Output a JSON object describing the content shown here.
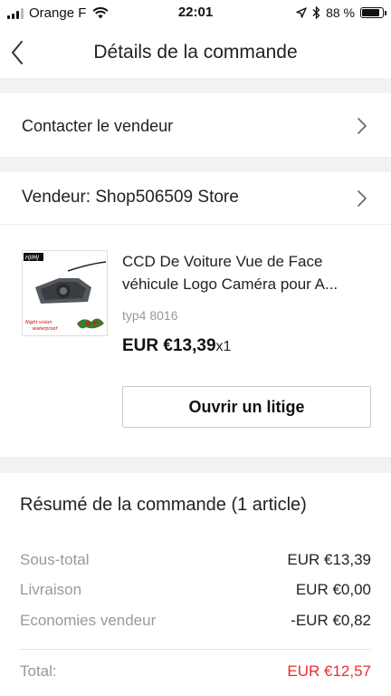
{
  "status_bar": {
    "carrier": "Orange F",
    "time": "22:01",
    "battery_percent": "88 %",
    "battery_level": 0.88
  },
  "nav": {
    "title": "Détails de la commande",
    "back_icon": "chevron-left-icon"
  },
  "contact_seller": {
    "label": "Contacter le vendeur",
    "icon": "chevron-right-icon"
  },
  "seller": {
    "label": "Vendeur: Shop506509 Store",
    "icon": "chevron-right-icon"
  },
  "product": {
    "name_line1": "CCD De Voiture Vue de Face",
    "name_line2": "véhicule Logo Caméra pour A...",
    "variant": "typ4 8016",
    "price": "EUR €13,39",
    "quantity": "x1",
    "image_brand": "HJIMJ",
    "image_caption_1": "Night vision",
    "image_caption_2": "waterproof",
    "dispute_button": "Ouvrir un litige"
  },
  "summary": {
    "title": "Résumé de la commande (1 article)",
    "lines": [
      {
        "label": "Sous-total",
        "value": "EUR €13,39"
      },
      {
        "label": "Livraison",
        "value": "EUR €0,00"
      },
      {
        "label": "Economies vendeur",
        "value": "-EUR €0,82"
      }
    ],
    "total_label": "Total:",
    "total_value": "EUR €12,57"
  },
  "colors": {
    "accent_red": "#e62e2e",
    "background": "#f2f2f2",
    "muted_text": "#999999"
  }
}
